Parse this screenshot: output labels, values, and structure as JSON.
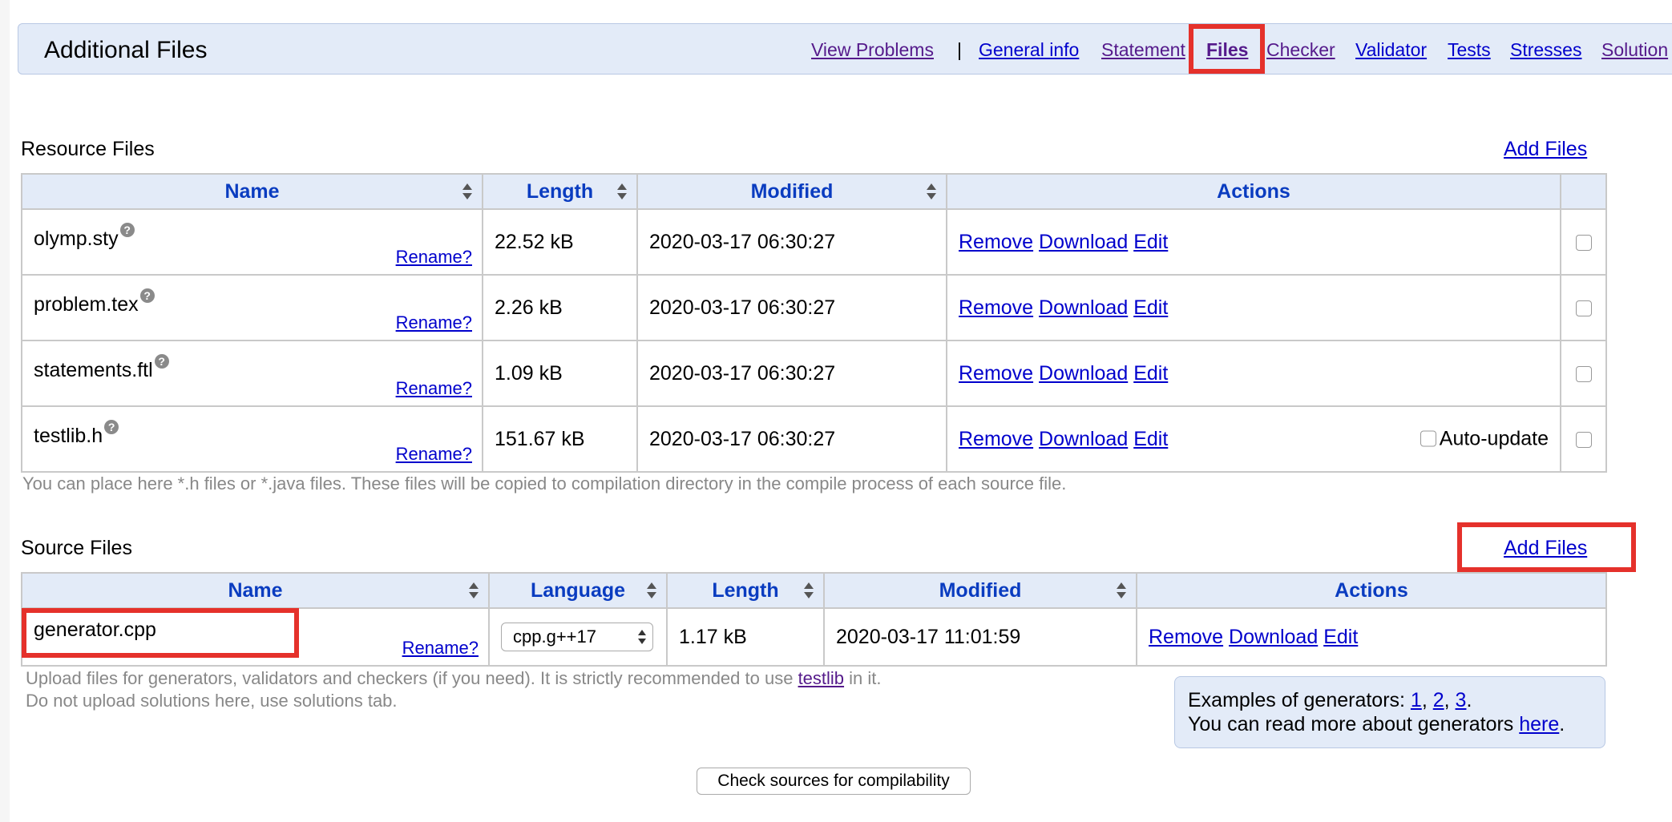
{
  "header": {
    "title": "Additional Files",
    "nav": {
      "view_problems": "View Problems",
      "separator": "|",
      "general_info": "General info",
      "statement": "Statement",
      "files": "Files",
      "checker": "Checker",
      "validator": "Validator",
      "tests": "Tests",
      "stresses": "Stresses",
      "solutions": "Solution"
    }
  },
  "resource": {
    "title": "Resource Files",
    "add_files": "Add Files",
    "columns": [
      "Name",
      "Length",
      "Modified",
      "Actions"
    ],
    "rows": [
      {
        "name": "olymp.sty",
        "length": "22.52 kB",
        "modified": "2020-03-17 06:30:27"
      },
      {
        "name": "problem.tex",
        "length": "2.26 kB",
        "modified": "2020-03-17 06:30:27"
      },
      {
        "name": "statements.ftl",
        "length": "1.09 kB",
        "modified": "2020-03-17 06:30:27"
      },
      {
        "name": "testlib.h",
        "length": "151.67 kB",
        "modified": "2020-03-17 06:30:27",
        "auto_update": "Auto-update"
      }
    ],
    "hint": "You can place here *.h files or *.java files. These files will be copied to compilation directory in the compile process of each source file."
  },
  "common": {
    "rename": "Rename?",
    "help": "?",
    "remove": "Remove",
    "download": "Download",
    "edit": "Edit"
  },
  "source": {
    "title": "Source Files",
    "add_files": "Add Files",
    "columns": [
      "Name",
      "Language",
      "Length",
      "Modified",
      "Actions"
    ],
    "rows": [
      {
        "name": "generator.cpp",
        "language": "cpp.g++17",
        "length": "1.17 kB",
        "modified": "2020-03-17 11:01:59"
      }
    ],
    "hint_line1_a": "Upload files for generators, validators and checkers (if you need). It is strictly recommended to use ",
    "hint_link": "testlib",
    "hint_line1_b": " in it.",
    "hint_line2": "Do not upload solutions here, use solutions tab."
  },
  "examples": {
    "line1_prefix": "Examples of generators: ",
    "links": [
      "1",
      "2",
      "3"
    ],
    "comma": ", ",
    "period": ".",
    "line2_prefix": "You can read more about generators ",
    "here": "here"
  },
  "check_button": "Check sources for compilability",
  "annotation_color": "#e5312b"
}
